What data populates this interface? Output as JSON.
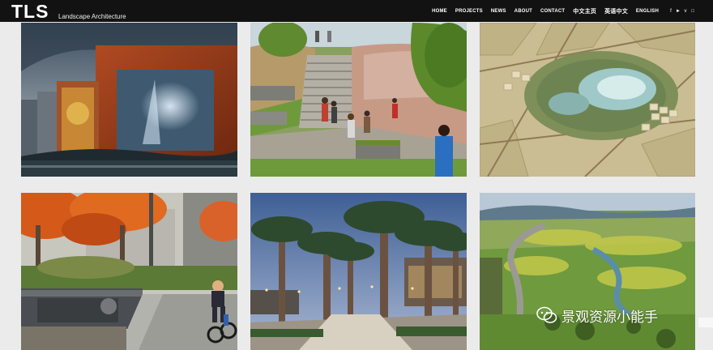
{
  "header": {
    "logo": "TLS",
    "logo_subtitle": "Landscape Architecture",
    "nav": [
      "HOME",
      "PROJECTS",
      "NEWS",
      "ABOUT",
      "CONTACT"
    ],
    "lang": [
      "中文主页",
      "英语中文",
      "ENGLISH"
    ],
    "social_icons": [
      "facebook-icon",
      "twitter-icon",
      "vimeo-icon",
      "instagram-icon"
    ]
  },
  "tiles": [
    {
      "subject": "red steel pavilion at dusk"
    },
    {
      "subject": "park staircase with visitors"
    },
    {
      "subject": "aerial masterplan with lake"
    },
    {
      "subject": "autumn plaza with child on bicycle"
    },
    {
      "subject": "palm tree promenade at twilight"
    },
    {
      "subject": "aerial river valley landscape"
    }
  ],
  "watermark": {
    "text": "景观资源小能手"
  },
  "colors": {
    "topbar": "#121212",
    "page_bg": "#ecebec"
  }
}
